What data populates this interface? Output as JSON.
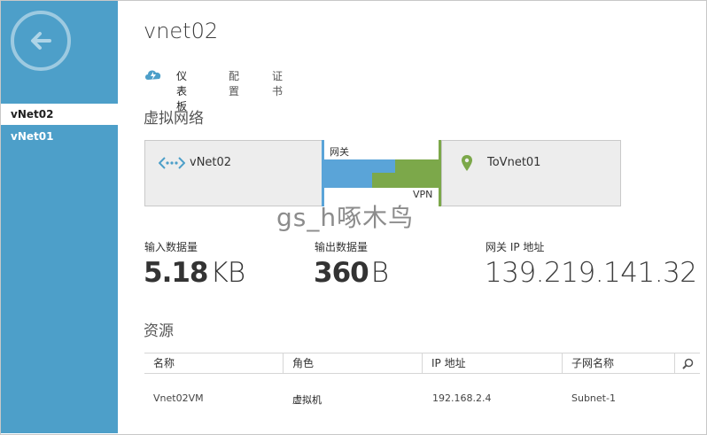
{
  "sidebar": {
    "back_icon": "back-arrow-icon",
    "items": [
      {
        "label": "vNet02",
        "active": true
      },
      {
        "label": "vNet01",
        "active": false
      }
    ]
  },
  "header": {
    "title": "vnet02",
    "tabs": [
      {
        "label": "仪表板",
        "active": true,
        "icon": "cloud-lightning-icon"
      },
      {
        "label": "配置"
      },
      {
        "label": "证书"
      }
    ]
  },
  "virtual_network": {
    "heading": "虚拟网络",
    "local": {
      "label": "vNet02",
      "icon": "virtual-network-icon"
    },
    "remote": {
      "label": "ToVnet01",
      "icon": "location-pin-icon"
    },
    "gateway_label": "网关",
    "vpn_label": "VPN"
  },
  "watermark": "gs_h啄木鸟",
  "stats": {
    "data_in": {
      "label": "输入数据量",
      "value": "5.18",
      "unit": "KB"
    },
    "data_out": {
      "label": "输出数据量",
      "value": "360",
      "unit": "B"
    },
    "gateway_ip": {
      "label": "网关 IP 地址",
      "value": "139.219.141.32"
    }
  },
  "resources": {
    "heading": "资源",
    "columns": [
      "名称",
      "角色",
      "IP 地址",
      "子网名称"
    ],
    "rows": [
      [
        "Vnet02VM",
        "虚拟机",
        "192.168.2.4",
        "Subnet-1"
      ]
    ]
  },
  "colors": {
    "sidebar": "#4d9fc9",
    "gateway_blue": "#5aa4d8",
    "vpn_green": "#7ca84a"
  }
}
